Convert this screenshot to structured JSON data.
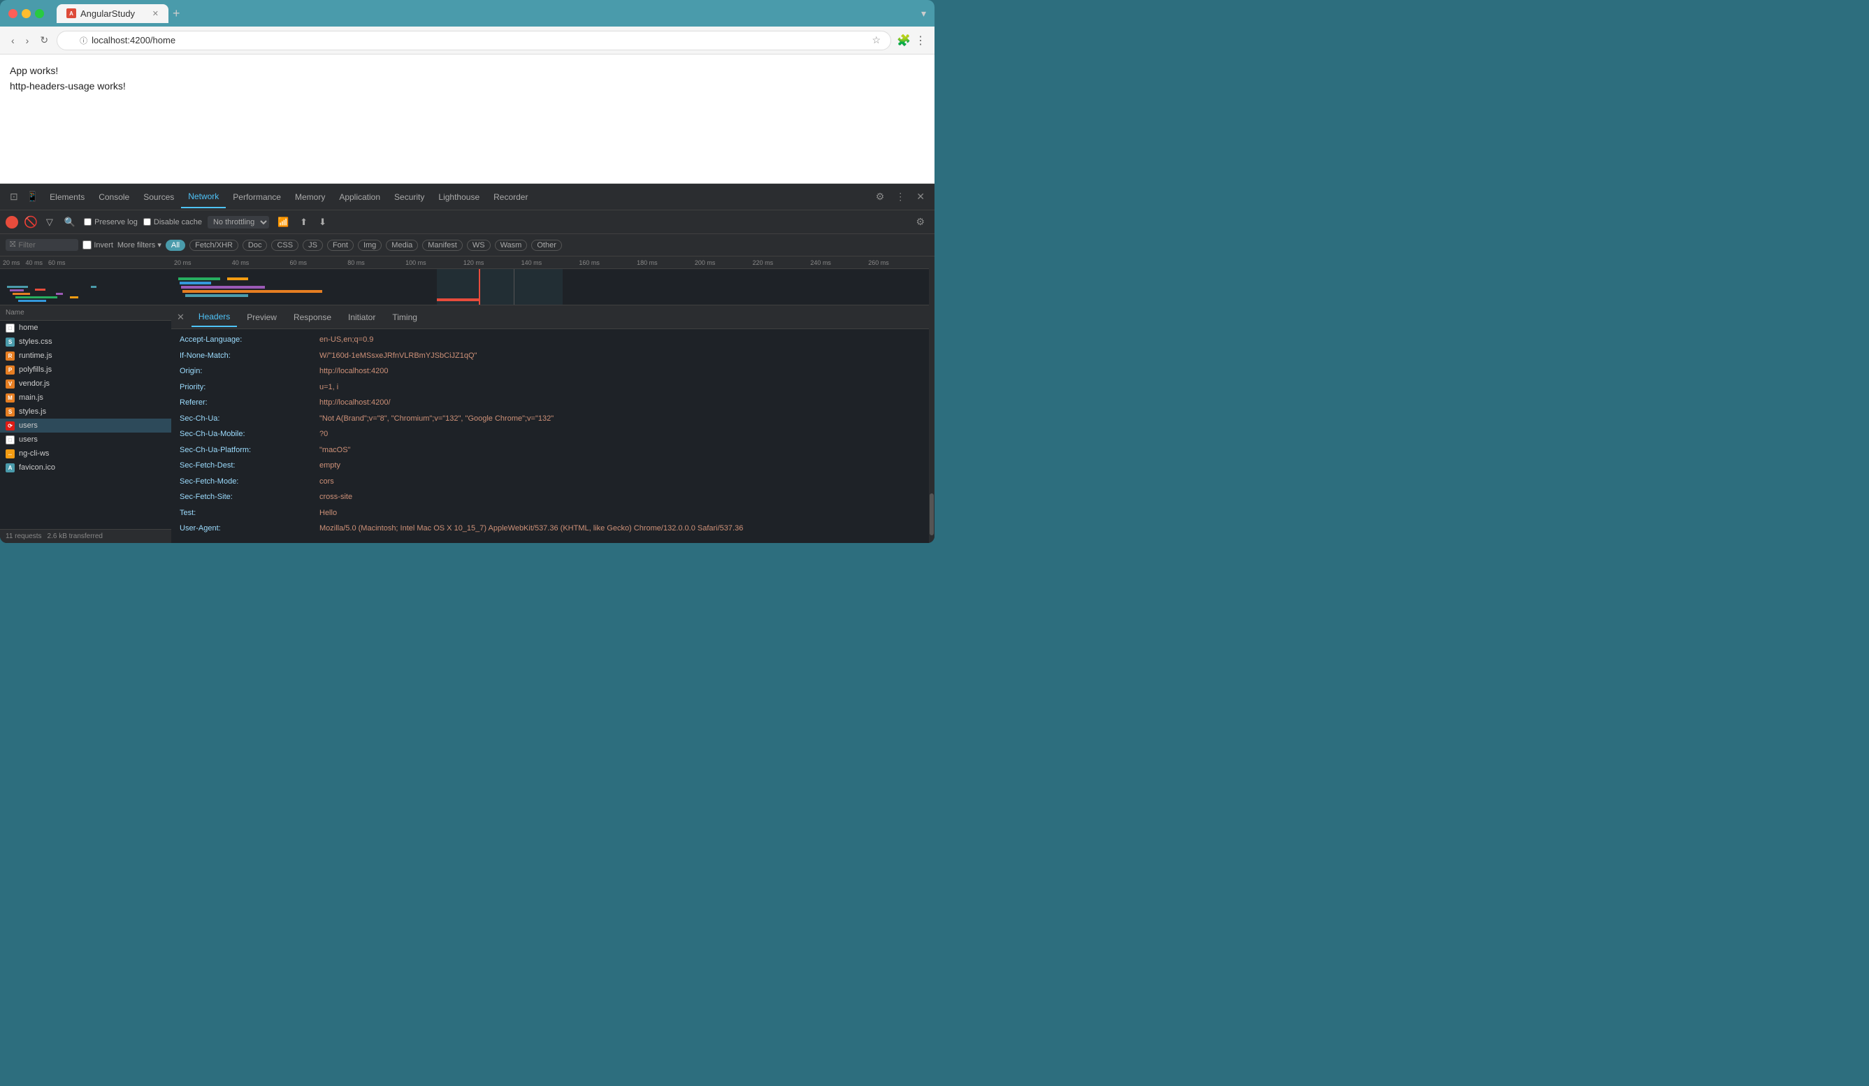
{
  "browser": {
    "tab_title": "AngularStudy",
    "tab_icon": "A",
    "url": "localhost:4200/home",
    "new_tab_label": "+",
    "back_tooltip": "Back",
    "forward_tooltip": "Forward",
    "refresh_tooltip": "Refresh"
  },
  "page": {
    "line1": "App works!",
    "line2": "http-headers-usage works!"
  },
  "devtools": {
    "tabs": [
      "Elements",
      "Console",
      "Sources",
      "Network",
      "Performance",
      "Memory",
      "Application",
      "Security",
      "Lighthouse",
      "Recorder"
    ],
    "active_tab": "Network",
    "toolbar": {
      "preserve_log": "Preserve log",
      "disable_cache": "Disable cache",
      "throttle": "No throttling"
    },
    "filter_bar": {
      "placeholder": "Filter",
      "invert": "Invert",
      "more_filters": "More filters",
      "pills": [
        "All",
        "Fetch/XHR",
        "Doc",
        "CSS",
        "JS",
        "Font",
        "Img",
        "Media",
        "Manifest",
        "WS",
        "Wasm",
        "Other"
      ],
      "active_pill": "All"
    },
    "timeline_marks": [
      "20 ms",
      "40 ms",
      "60 ms",
      "80 ms",
      "100 ms",
      "120 ms",
      "140 ms",
      "160 ms",
      "180 ms",
      "200 ms",
      "220 ms",
      "240 ms",
      "260 ms"
    ],
    "files": [
      {
        "name": "home",
        "type": "doc"
      },
      {
        "name": "styles.css",
        "type": "css"
      },
      {
        "name": "runtime.js",
        "type": "js"
      },
      {
        "name": "polyfills.js",
        "type": "js"
      },
      {
        "name": "vendor.js",
        "type": "js"
      },
      {
        "name": "main.js",
        "type": "js"
      },
      {
        "name": "styles.js",
        "type": "js"
      },
      {
        "name": "users",
        "type": "angular"
      },
      {
        "name": "users",
        "type": "doc"
      },
      {
        "name": "ng-cli-ws",
        "type": "ws"
      },
      {
        "name": "favicon.ico",
        "type": "img"
      }
    ],
    "status_bar": {
      "requests": "11 requests",
      "transferred": "2.6 kB transferred"
    },
    "headers_panel": {
      "tabs": [
        "Headers",
        "Preview",
        "Response",
        "Initiator",
        "Timing"
      ],
      "active_tab": "Headers",
      "rows": [
        {
          "key": "Accept-Language:",
          "val": "en-US,en;q=0.9"
        },
        {
          "key": "If-None-Match:",
          "val": "W/\"160d-1eMSsxeJRfnVLRBmYJSbCiJZ1qQ\""
        },
        {
          "key": "Origin:",
          "val": "http://localhost:4200"
        },
        {
          "key": "Priority:",
          "val": "u=1, i"
        },
        {
          "key": "Referer:",
          "val": "http://localhost:4200/"
        },
        {
          "key": "Sec-Ch-Ua:",
          "val": "\"Not A(Brand\";v=\"8\", \"Chromium\";v=\"132\", \"Google Chrome\";v=\"132\""
        },
        {
          "key": "Sec-Ch-Ua-Mobile:",
          "val": "?0"
        },
        {
          "key": "Sec-Ch-Ua-Platform:",
          "val": "\"macOS\""
        },
        {
          "key": "Sec-Fetch-Dest:",
          "val": "empty"
        },
        {
          "key": "Sec-Fetch-Mode:",
          "val": "cors"
        },
        {
          "key": "Sec-Fetch-Site:",
          "val": "cross-site"
        },
        {
          "key": "Test:",
          "val": "Hello"
        },
        {
          "key": "User-Agent:",
          "val": "Mozilla/5.0 (Macintosh; Intel Mac OS X 10_15_7) AppleWebKit/537.36 (KHTML, like Gecko) Chrome/132.0.0.0 Safari/537.36"
        }
      ]
    }
  }
}
